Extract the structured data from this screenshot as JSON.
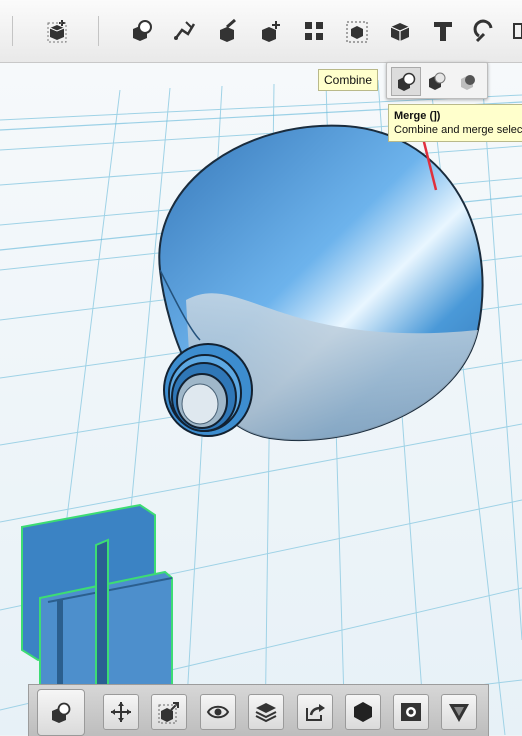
{
  "toolbar": {
    "icons": [
      "add-object-icon",
      "combine-icon",
      "sketch-icon",
      "construct-icon",
      "modify-icon",
      "pattern-icon",
      "snap-icon",
      "primitives-icon",
      "text-icon",
      "measure-icon"
    ]
  },
  "tooltips": {
    "combine": "Combine",
    "merge_title": "Merge (])",
    "merge_desc": "Combine and merge selec"
  },
  "flyout": {
    "items": [
      "merge-icon",
      "subtract-icon",
      "intersect-icon"
    ],
    "selected": "merge-icon"
  },
  "bottom_bar": {
    "icons": [
      "combine-icon",
      "move-icon",
      "scale-icon",
      "view-icon",
      "layers-icon",
      "export-icon",
      "material-icon",
      "snapshot-icon",
      "render-icon"
    ]
  },
  "colors": {
    "accent_arrow": "#e0303d",
    "model_blue": "#3b8fd3",
    "grid": "#7ec3dc"
  }
}
